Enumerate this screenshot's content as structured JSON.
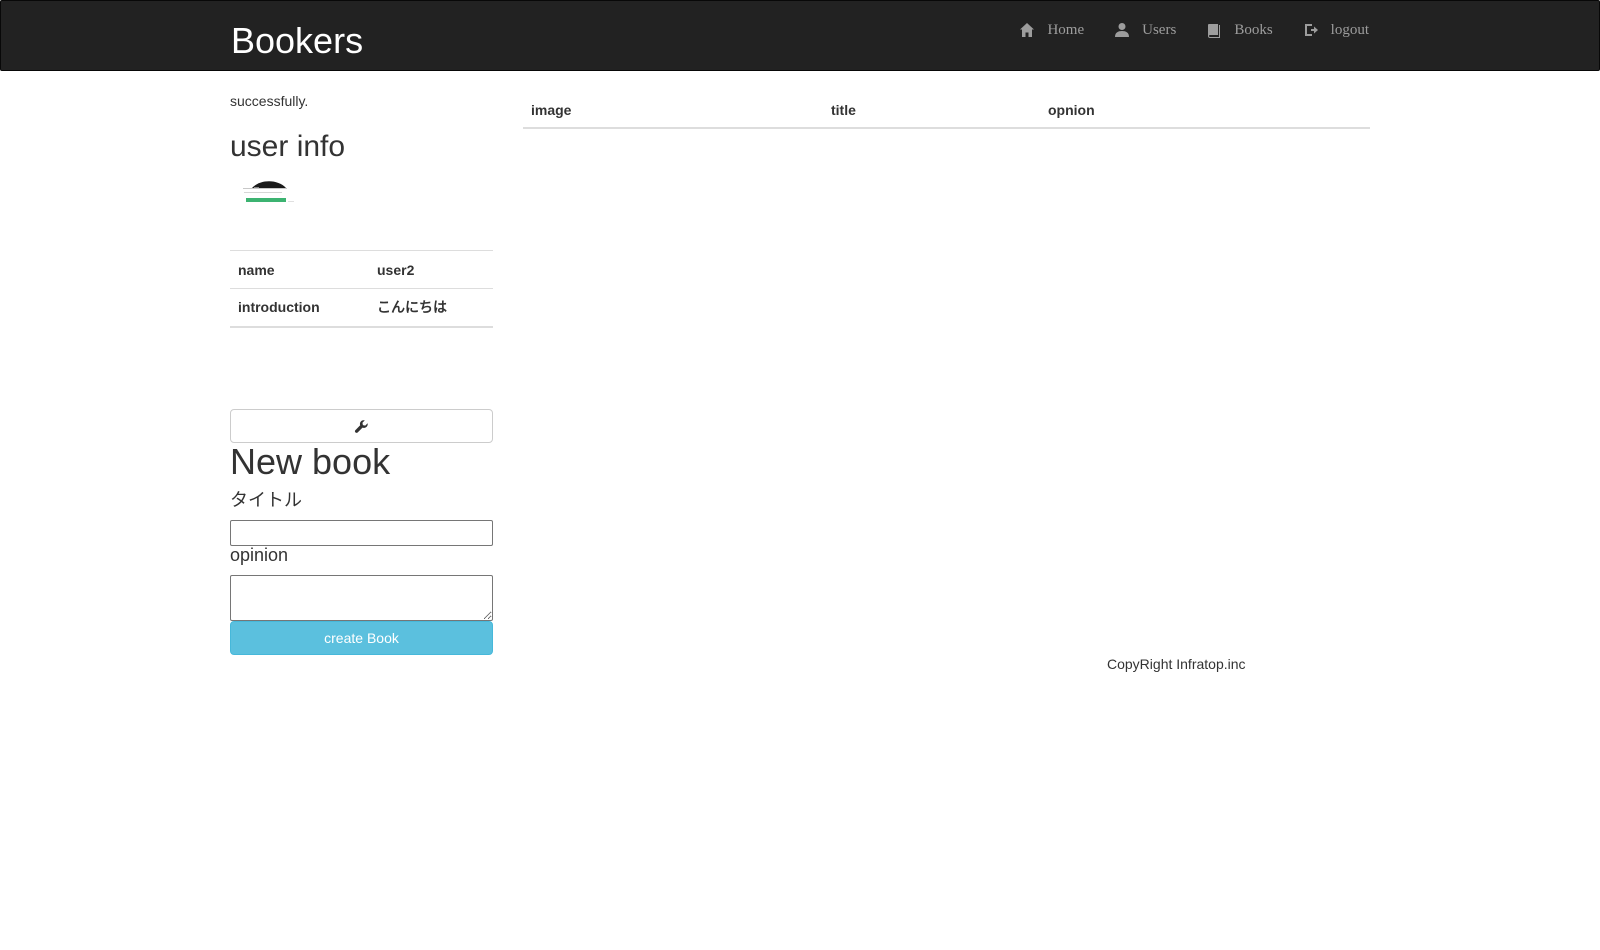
{
  "navbar": {
    "brand": "Bookers",
    "links": [
      {
        "label": "Home",
        "icon": "home-icon"
      },
      {
        "label": "Users",
        "icon": "user-icon"
      },
      {
        "label": "Books",
        "icon": "book-icon"
      },
      {
        "label": "logout",
        "icon": "logout-icon"
      }
    ]
  },
  "flash_message": "successfully.",
  "user_info": {
    "heading": "user info",
    "rows": [
      {
        "label": "name",
        "value": "user2"
      },
      {
        "label": "introduction",
        "value": "こんにちは"
      }
    ],
    "edit_icon": "wrench-icon"
  },
  "new_book": {
    "heading": "New book",
    "title_label": "タイトル",
    "title_value": "",
    "opinion_label": "opinion",
    "opinion_value": "",
    "submit_label": "create Book"
  },
  "books_table": {
    "headers": [
      "image",
      "title",
      "opnion"
    ],
    "rows": []
  },
  "footer": {
    "text": "CopyRight Infratop.inc"
  },
  "colors": {
    "navbar_bg": "#222222",
    "nav_link": "#9d9d9d",
    "primary_button": "#5bc0de"
  }
}
